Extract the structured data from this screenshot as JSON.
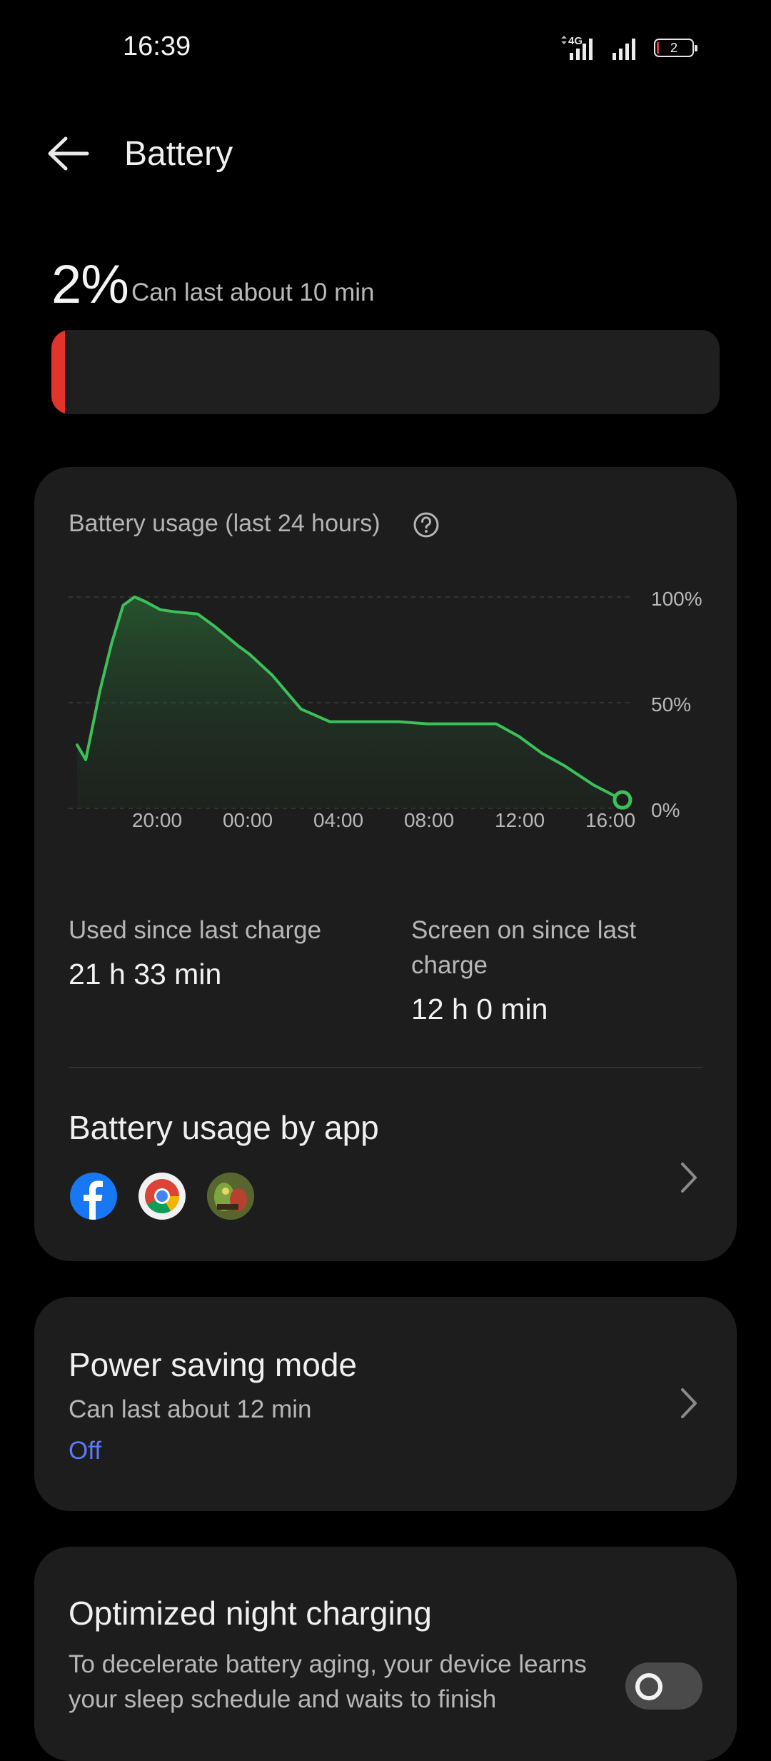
{
  "status_bar": {
    "time": "16:39",
    "network": "4G",
    "battery_level": "2"
  },
  "header": {
    "title": "Battery"
  },
  "battery": {
    "percent": "2%",
    "estimate": "Can last about 10 min",
    "level_fraction": 0.02,
    "bar_color": "#e2342b"
  },
  "usage_card": {
    "title": "Battery usage (last 24 hours)",
    "y_ticks": [
      "100%",
      "50%",
      "0%"
    ],
    "x_ticks": [
      "20:00",
      "00:00",
      "04:00",
      "08:00",
      "12:00",
      "16:00"
    ],
    "used_since_label": "Used since last charge",
    "used_since_value": "21 h 33 min",
    "screen_on_label": "Screen on since last charge",
    "screen_on_value": "12 h 0 min",
    "apps_title": "Battery usage by app",
    "apps": [
      {
        "name": "Facebook",
        "icon": "facebook-icon"
      },
      {
        "name": "Chrome",
        "icon": "chrome-icon"
      },
      {
        "name": "Game",
        "icon": "game-app-icon"
      }
    ]
  },
  "chart_data": {
    "type": "area",
    "title": "Battery usage (last 24 hours)",
    "xlabel": "",
    "ylabel": "",
    "x_ticks": [
      "20:00",
      "00:00",
      "04:00",
      "08:00",
      "12:00",
      "16:00"
    ],
    "ylim": [
      0,
      100
    ],
    "y_ticks": [
      0,
      50,
      100
    ],
    "grid": true,
    "line_color": "#3cc15a",
    "series": [
      {
        "x": [
          -2.6,
          -2.3,
          -1.8,
          -1.4,
          -1.0,
          -0.6,
          -0.25,
          0.3,
          0.8,
          1.6,
          2.2,
          3.0,
          3.4,
          4.2,
          5.2,
          6.2,
          7.2,
          8.0,
          8.6,
          9.6,
          10.6,
          11.4,
          12.0,
          12.8,
          13.6,
          14.4,
          15.4,
          16.4
        ],
        "y": [
          30,
          23,
          56,
          78,
          96,
          100,
          98,
          94,
          93,
          92,
          86,
          77,
          73,
          63,
          47,
          41,
          41,
          41,
          41,
          40,
          40,
          40,
          40,
          34,
          26,
          20,
          11,
          4
        ]
      }
    ]
  },
  "power_saving": {
    "title": "Power saving mode",
    "estimate": "Can last about 12 min",
    "state": "Off"
  },
  "night_charging": {
    "title": "Optimized night charging",
    "description": "To decelerate battery aging, your device learns your sleep schedule and waits to finish",
    "enabled": false
  },
  "colors": {
    "accent": "#5b79f3",
    "battery_low": "#e2342b",
    "chart_line": "#3cc15a",
    "card": "#1d1d1d"
  }
}
